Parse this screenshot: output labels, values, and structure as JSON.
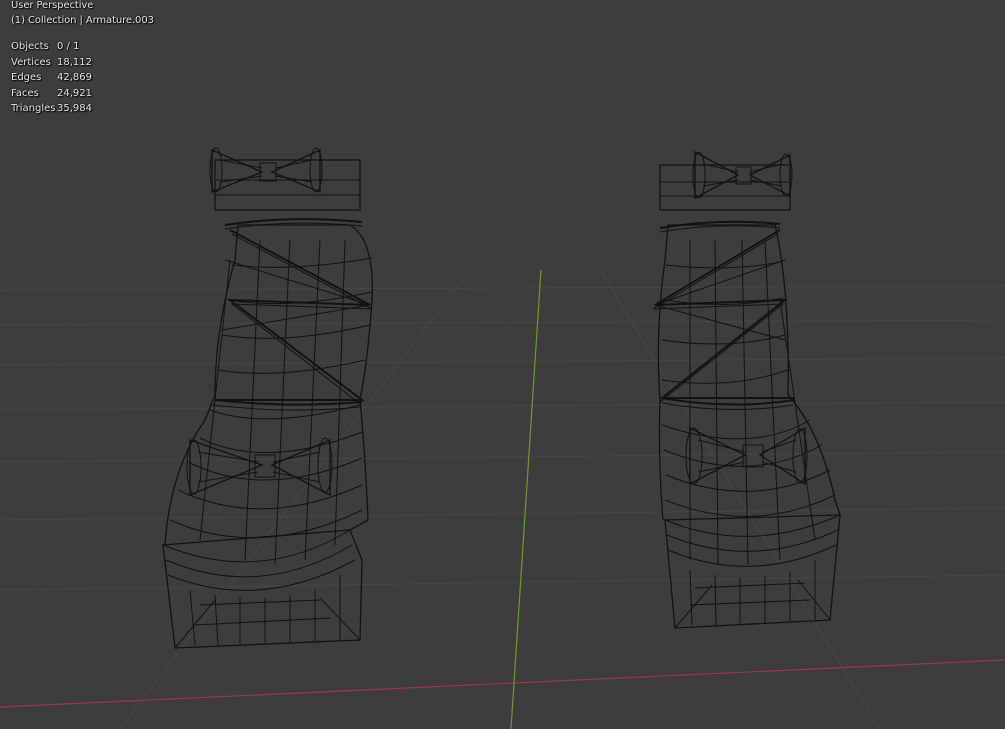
{
  "viewport": {
    "view_name": "User Perspective",
    "collection_info": "(1) Collection | Armature.003",
    "background": "#3d3d3d",
    "grid_color": "#474747",
    "x_axis_color": "#9a3a42",
    "y_axis_color": "#6f9a2a",
    "wire_color": "#111111"
  },
  "stats": [
    {
      "label": "Objects",
      "value": "0 / 1"
    },
    {
      "label": "Vertices",
      "value": "18,112"
    },
    {
      "label": "Edges",
      "value": "42,869"
    },
    {
      "label": "Faces",
      "value": "24,921"
    },
    {
      "label": "Triangles",
      "value": "35,984"
    }
  ],
  "objects": [
    {
      "name": "left-shoe-wireframe"
    },
    {
      "name": "right-shoe-wireframe"
    }
  ]
}
